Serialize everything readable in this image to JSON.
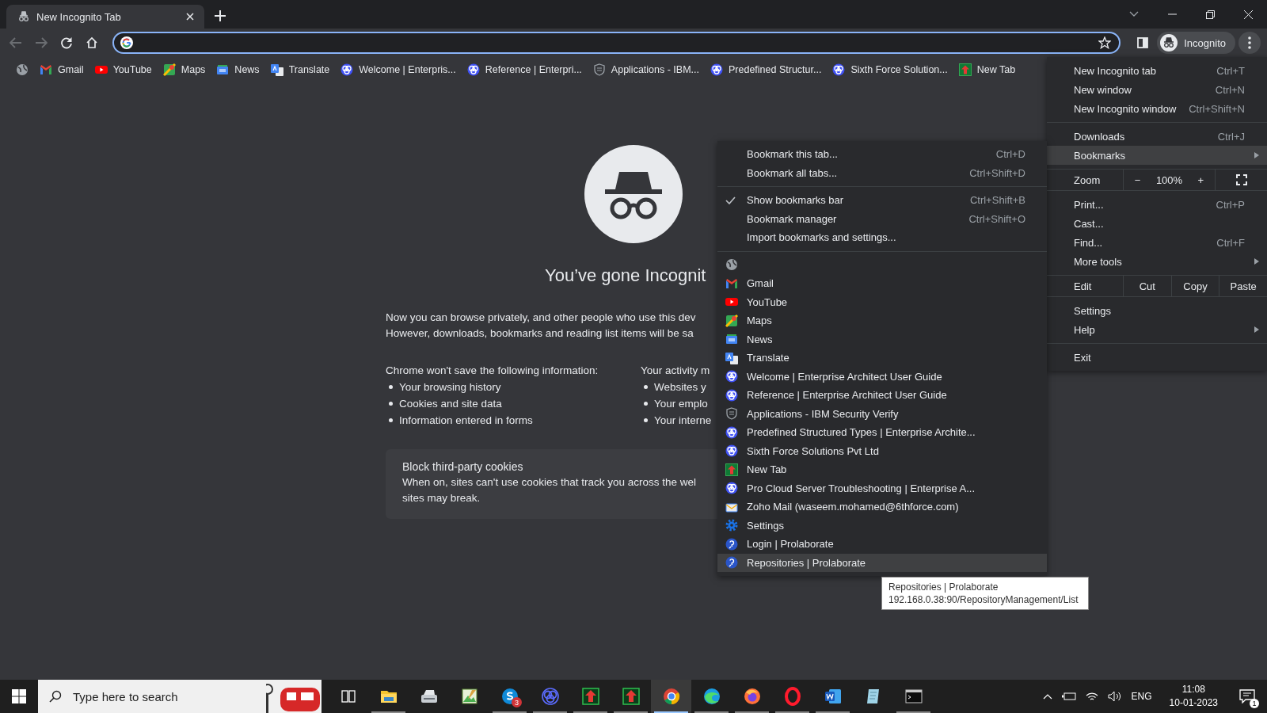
{
  "tab": {
    "title": "New Incognito Tab"
  },
  "toolbar": {
    "back_disabled": true,
    "forward_disabled": true,
    "profile_label": "Incognito"
  },
  "bookmarks_bar": [
    {
      "kind": "globe"
    },
    {
      "kind": "gmail",
      "label": "Gmail"
    },
    {
      "kind": "youtube",
      "label": "YouTube"
    },
    {
      "kind": "maps",
      "label": "Maps"
    },
    {
      "kind": "news",
      "label": "News"
    },
    {
      "kind": "translate",
      "label": "Translate"
    },
    {
      "kind": "ea",
      "label": "Welcome | Enterpris..."
    },
    {
      "kind": "ea",
      "label": "Reference | Enterpri..."
    },
    {
      "kind": "shield",
      "label": "Applications - IBM..."
    },
    {
      "kind": "ea",
      "label": "Predefined Structur..."
    },
    {
      "kind": "ea",
      "label": "Sixth Force Solution..."
    },
    {
      "kind": "newtab",
      "label": "New Tab"
    }
  ],
  "page": {
    "title": "You’ve gone Incognit",
    "intro": [
      "Now you can browse privately, and other people who use this dev",
      "However, downloads, bookmarks and reading list items will be sa"
    ],
    "columns": [
      {
        "heading": "Chrome won't save the following information:",
        "items": [
          "Your browsing history",
          "Cookies and site data",
          "Information entered in forms"
        ]
      },
      {
        "heading": "Your activity m",
        "items": [
          "Websites y",
          "Your emplo",
          "Your interne"
        ]
      }
    ],
    "cookies": {
      "title": "Block third-party cookies",
      "lines": [
        "When on, sites can't use cookies that track you across the wel",
        "sites may break."
      ]
    }
  },
  "main_menu": [
    [
      {
        "kind": "item",
        "label": "New Incognito tab",
        "shortcut": "Ctrl+T",
        "submenu": false,
        "highlighted": false
      },
      {
        "kind": "item",
        "label": "New window",
        "shortcut": "Ctrl+N",
        "submenu": false,
        "highlighted": false
      },
      {
        "kind": "item",
        "label": "New Incognito window",
        "shortcut": "Ctrl+Shift+N",
        "submenu": false,
        "highlighted": false
      }
    ],
    [
      {
        "kind": "item",
        "label": "Downloads",
        "shortcut": "Ctrl+J",
        "submenu": false,
        "highlighted": false
      },
      {
        "kind": "item",
        "label": "Bookmarks",
        "submenu": true,
        "highlighted": true
      }
    ],
    [
      {
        "kind": "zoom",
        "label": "Zoom",
        "minus": "−",
        "value": "100%",
        "plus": "+"
      }
    ],
    [
      {
        "kind": "item",
        "label": "Print...",
        "shortcut": "Ctrl+P",
        "submenu": false,
        "highlighted": false
      },
      {
        "kind": "item",
        "label": "Cast...",
        "submenu": false,
        "highlighted": false
      },
      {
        "kind": "item",
        "label": "Find...",
        "shortcut": "Ctrl+F",
        "submenu": false,
        "highlighted": false
      },
      {
        "kind": "item",
        "label": "More tools",
        "submenu": true,
        "highlighted": false
      }
    ],
    [
      {
        "kind": "edit",
        "label": "Edit",
        "actions": [
          "Cut",
          "Copy",
          "Paste"
        ]
      }
    ],
    [
      {
        "kind": "item",
        "label": "Settings",
        "submenu": false,
        "highlighted": false
      },
      {
        "kind": "item",
        "label": "Help",
        "submenu": true,
        "highlighted": false
      }
    ],
    [
      {
        "kind": "item",
        "label": "Exit",
        "submenu": false,
        "highlighted": false
      }
    ]
  ],
  "bookmarks_menu": {
    "action_groups": [
      [
        {
          "label": "Bookmark this tab...",
          "shortcut": "Ctrl+D",
          "checked": false
        },
        {
          "label": "Bookmark all tabs...",
          "shortcut": "Ctrl+Shift+D",
          "checked": false
        }
      ],
      [
        {
          "label": "Show bookmarks bar",
          "shortcut": "Ctrl+Shift+B",
          "checked": true
        },
        {
          "label": "Bookmark manager",
          "shortcut": "Ctrl+Shift+O",
          "checked": false
        },
        {
          "label": "Import bookmarks and settings...",
          "checked": false
        }
      ]
    ],
    "bookmarks": [
      {
        "kind": "globe",
        "highlighted": false
      },
      {
        "kind": "gmail",
        "label": "Gmail",
        "highlighted": false
      },
      {
        "kind": "youtube",
        "label": "YouTube",
        "highlighted": false
      },
      {
        "kind": "maps",
        "label": "Maps",
        "highlighted": false
      },
      {
        "kind": "news",
        "label": "News",
        "highlighted": false
      },
      {
        "kind": "translate",
        "label": "Translate",
        "highlighted": false
      },
      {
        "kind": "ea",
        "label": "Welcome | Enterprise Architect User Guide",
        "highlighted": false
      },
      {
        "kind": "ea",
        "label": "Reference | Enterprise Architect User Guide",
        "highlighted": false
      },
      {
        "kind": "shield",
        "label": "Applications - IBM Security Verify",
        "highlighted": false
      },
      {
        "kind": "ea",
        "label": "Predefined Structured Types | Enterprise Archite...",
        "highlighted": false
      },
      {
        "kind": "ea",
        "label": "Sixth Force Solutions Pvt Ltd",
        "highlighted": false
      },
      {
        "kind": "newtab",
        "label": "New Tab",
        "highlighted": false
      },
      {
        "kind": "ea",
        "label": "Pro Cloud Server Troubleshooting | Enterprise A...",
        "highlighted": false
      },
      {
        "kind": "zoho",
        "label": "Zoho Mail (waseem.mohamed@6thforce.com)",
        "highlighted": false
      },
      {
        "kind": "gear",
        "label": "Settings",
        "highlighted": false
      },
      {
        "kind": "prolab",
        "label": "Login | Prolaborate",
        "highlighted": false
      },
      {
        "kind": "prolab",
        "label": "Repositories | Prolaborate",
        "highlighted": true
      }
    ]
  },
  "tooltip": {
    "title": "Repositories | Prolaborate",
    "url": "192.168.0.38:90/RepositoryManagement/List"
  },
  "taskbar": {
    "search_placeholder": "Type here to search",
    "apps": [
      {
        "kind": "taskview",
        "running": false,
        "active": false
      },
      {
        "kind": "folder",
        "running": true,
        "active": false
      },
      {
        "kind": "scanner",
        "running": false,
        "active": false
      },
      {
        "kind": "image",
        "running": false,
        "active": false
      },
      {
        "kind": "skype",
        "running": true,
        "active": false,
        "badge": "3"
      },
      {
        "kind": "ea",
        "running": true,
        "active": false
      },
      {
        "kind": "greenarrow",
        "running": true,
        "active": false
      },
      {
        "kind": "greenarrow",
        "running": true,
        "active": false
      },
      {
        "kind": "chrome",
        "running": true,
        "active": true
      },
      {
        "kind": "edge",
        "running": true,
        "active": false
      },
      {
        "kind": "firefox",
        "running": true,
        "active": false
      },
      {
        "kind": "opera",
        "running": true,
        "active": false
      },
      {
        "kind": "word",
        "running": true,
        "active": false
      },
      {
        "kind": "notes",
        "running": false,
        "active": false
      },
      {
        "kind": "terminal",
        "running": true,
        "active": false
      }
    ],
    "language": "ENG",
    "time": "11:08",
    "date": "10-01-2023",
    "notification_count": "1"
  }
}
